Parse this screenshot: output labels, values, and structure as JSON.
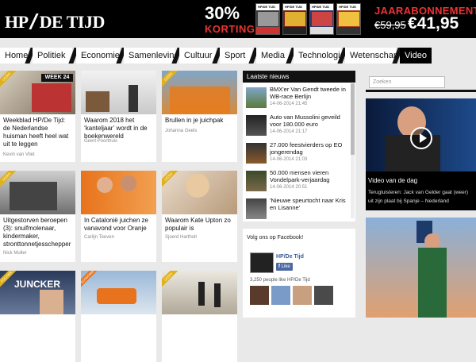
{
  "header": {
    "logo_left": "HP",
    "logo_right": "DE TIJD",
    "promo": {
      "percent": "30%",
      "korting": "KORTING",
      "jaar": "JAARABONNEMENT",
      "old_price": "€59,95",
      "new_price": "€41,95",
      "magazine_label": "HP/DE TIJD"
    }
  },
  "nav": {
    "items": [
      "Home",
      "Politiek",
      "Economie",
      "Samenleving",
      "Cultuur",
      "Sport",
      "Media",
      "Technologie",
      "Wetenschap",
      "Video"
    ]
  },
  "articles": [
    {
      "badge": "LEZEN",
      "title": "Weekblad HP/De Tijd: de Nederlandse huisman heeft heel wat uit te leggen",
      "author": "Kevin van Vliet",
      "thumb_text": "WEEK 24"
    },
    {
      "badge": "",
      "title": "Waarom 2018 het ‘kanteljaar’ wordt in de boekenwereld",
      "author": "Geert Poorthuis"
    },
    {
      "badge": "LEZEN",
      "title": "Brullen in je juichpak",
      "author": "Johanna Geels"
    },
    {
      "badge": "LEZEN",
      "title": "Uitgestorven beroepen (3): snuifmolenaar, kindermaker, stronttonnetjesschepper",
      "author": "Nick Muller"
    },
    {
      "badge": "",
      "title": "In Catalonië juichen ze vanavond voor Oranje",
      "author": "Carlijn Teeven"
    },
    {
      "badge": "LEZEN",
      "title": "Waarom Kate Upton zo populair is",
      "author": "Sjoerd Hartholt"
    },
    {
      "badge": "POLITIEK",
      "title": "",
      "author": "",
      "thumb_text": "JUNCKER"
    },
    {
      "badge": "ECONOMIE",
      "title": "",
      "author": ""
    },
    {
      "badge": "LEZEN",
      "title": "",
      "author": ""
    }
  ],
  "latest_news": {
    "header": "Laatste nieuws",
    "items": [
      {
        "title": "BMX'er Van Gendt tweede in WB-race Berlijn",
        "time": "14-06-2014 21:45"
      },
      {
        "title": "Auto van Mussolini geveild voor 180.000 euro",
        "time": "14-06-2014 21:17"
      },
      {
        "title": "27.000 feestvierders op EO jongerendag",
        "time": "14-06-2014 21:03"
      },
      {
        "title": "50.000 mensen vieren Vondelpark-verjaardag",
        "time": "14-06-2014 20:51"
      },
      {
        "title": "'Nieuwe speurtocht naar Kris en Lisanne'",
        "time": ""
      }
    ]
  },
  "facebook": {
    "header": "Volg ons op Facebook!",
    "page_name": "HP/De Tijd",
    "like_label": "Like",
    "count_text": "3,250 people like HP/De Tijd"
  },
  "sidebar": {
    "search_placeholder": "Zoeken",
    "video_title": "Video van de dag",
    "video_desc": "Terugluisteren: Jack van Gelder gaat (weer) uit zijn plaat bij Spanje – Nederland"
  },
  "colors": {
    "accent_red": "#e33333",
    "badge_yellow": "#e2b019",
    "badge_orange": "#e8731c",
    "nav_dark": "#000000",
    "fb_blue": "#3b5998"
  }
}
